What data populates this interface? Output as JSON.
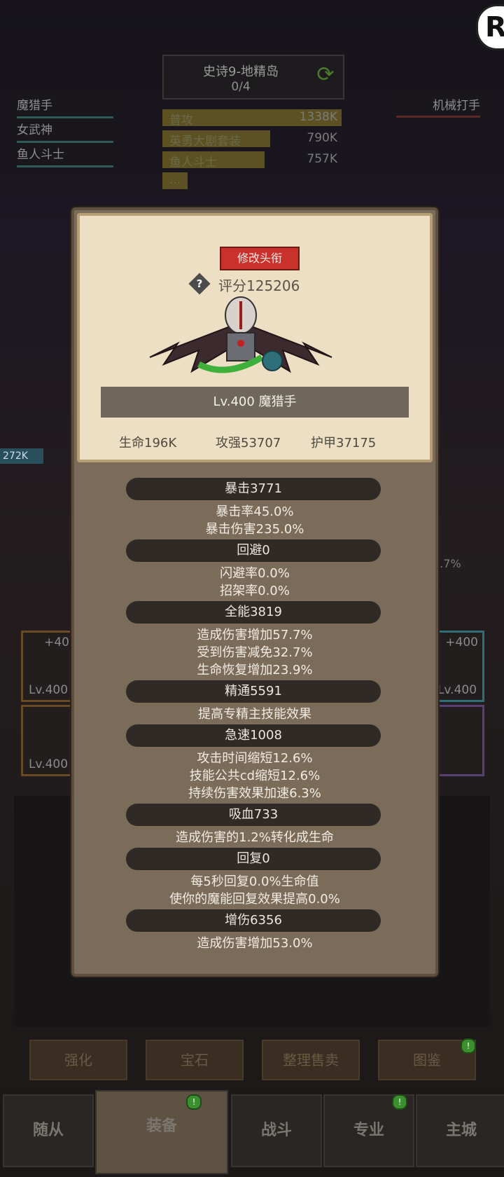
{
  "background": {
    "stage_title": "史诗9-地精岛",
    "stage_progress": "0/4",
    "team": [
      "魔猎手",
      "女武神",
      "鱼人斗士"
    ],
    "enemy": "机械打手",
    "damage_rows": [
      {
        "name": "普攻",
        "value": "1338K",
        "fraction": 1.0
      },
      {
        "name": "英勇大剧套装",
        "value": "790K",
        "fraction": 0.6
      },
      {
        "name": "鱼人斗士",
        "value": "757K",
        "fraction": 0.57
      },
      {
        "name": "...",
        "value": "",
        "fraction": 0.14
      }
    ],
    "hp_label": "272K",
    "pct_label": "7.7%",
    "slot_levels": [
      "Lv.400",
      "Lv.400",
      "Lv.400"
    ],
    "slot_plus": [
      "+40",
      "+400"
    ],
    "action_buttons": [
      "强化",
      "宝石",
      "整理售卖",
      "图鉴"
    ],
    "nav_tabs": [
      "随从",
      "装备",
      "战斗",
      "专业",
      "主城"
    ],
    "badge": "!"
  },
  "popup": {
    "rename_button": "修改头衔",
    "score_icon": "?",
    "score": "评分125206",
    "character": "Lv.400 魔猎手",
    "base_stats": [
      "生命196K",
      "攻强53707",
      "护甲37175"
    ],
    "sections": [
      {
        "title": "暴击3771",
        "lines": [
          "暴击率45.0%",
          "暴击伤害235.0%"
        ]
      },
      {
        "title": "回避0",
        "lines": [
          "闪避率0.0%",
          "招架率0.0%"
        ]
      },
      {
        "title": "全能3819",
        "lines": [
          "造成伤害增加57.7%",
          "受到伤害减免32.7%",
          "生命恢复增加23.9%"
        ]
      },
      {
        "title": "精通5591",
        "lines": [
          "提高专精主技能效果"
        ]
      },
      {
        "title": "急速1008",
        "lines": [
          "攻击时间缩短12.6%",
          "技能公共cd缩短12.6%",
          "持续伤害效果加速6.3%"
        ]
      },
      {
        "title": "吸血733",
        "lines": [
          "造成伤害的1.2%转化成生命"
        ]
      },
      {
        "title": "回复0",
        "lines": [
          "每5秒回复0.0%生命值",
          "使你的魔能回复效果提高0.0%"
        ]
      },
      {
        "title": "增伤6356",
        "lines": [
          "造成伤害增加53.0%"
        ]
      }
    ]
  }
}
